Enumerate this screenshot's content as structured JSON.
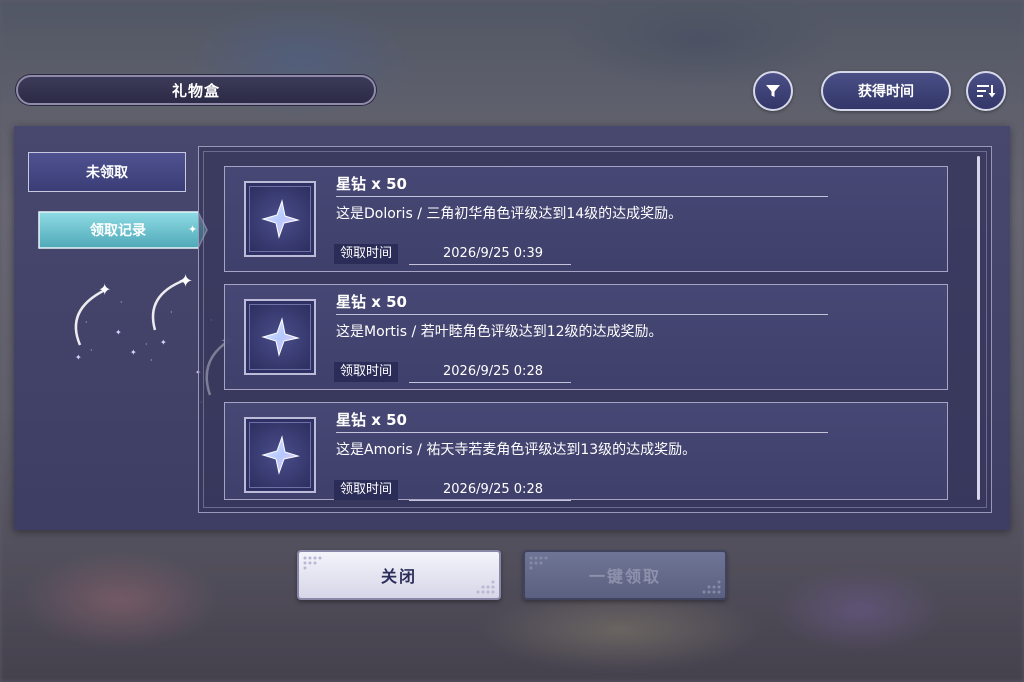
{
  "header": {
    "title": "礼物盒",
    "filter_icon": "filter-icon",
    "sort_label": "获得时间",
    "sort_icon": "sort-descending-icon"
  },
  "tabs": [
    {
      "label": "未领取",
      "active": false
    },
    {
      "label": "领取记录",
      "active": true
    }
  ],
  "records": [
    {
      "item_name": "星钻 x 50",
      "icon": "star-diamond-icon",
      "description": "这是Doloris / 三角初华角色评级达到14级的达成奖励。",
      "time_label": "领取时间",
      "time": "2026/9/25 0:39"
    },
    {
      "item_name": "星钻 x 50",
      "icon": "star-diamond-icon",
      "description": "这是Mortis / 若叶睦角色评级达到12级的达成奖励。",
      "time_label": "领取时间",
      "time": "2026/9/25 0:28"
    },
    {
      "item_name": "星钻 x 50",
      "icon": "star-diamond-icon",
      "description": "这是Amoris / 祐天寺若麦角色评级达到13级的达成奖励。",
      "time_label": "领取时间",
      "time": "2026/9/25 0:28"
    }
  ],
  "footer": {
    "close_label": "关闭",
    "claim_all_label": "一键领取",
    "claim_all_enabled": false
  },
  "colors": {
    "panel": "#46466e",
    "accent_tab": "#6fc3d0",
    "button_dark": "#3a3d76"
  }
}
